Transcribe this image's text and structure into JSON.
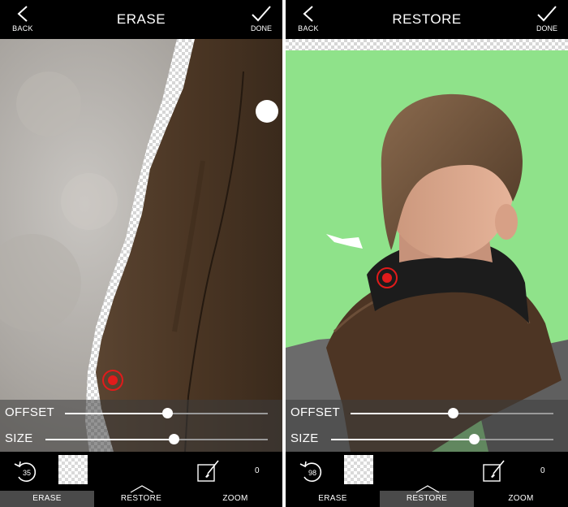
{
  "left_panel": {
    "topbar": {
      "back_label": "BACK",
      "title": "ERASE",
      "done_label": "DONE"
    },
    "sliders": {
      "offset_label": "OFFSET",
      "offset_value": 0.5,
      "size_label": "SIZE",
      "size_value": 0.57
    },
    "bottom": {
      "undo_count": "35",
      "counter": "0"
    },
    "tabs": {
      "erase": "ERASE",
      "restore": "RESTORE",
      "zoom": "ZOOM",
      "active": "erase"
    }
  },
  "right_panel": {
    "topbar": {
      "back_label": "BACK",
      "title": "RESTORE",
      "done_label": "DONE"
    },
    "sliders": {
      "offset_label": "OFFSET",
      "offset_value": 0.5,
      "size_label": "SIZE",
      "size_value": 0.57
    },
    "bottom": {
      "undo_count": "98",
      "counter": "0"
    },
    "tabs": {
      "erase": "ERASE",
      "restore": "RESTORE",
      "zoom": "ZOOM",
      "active": "restore"
    }
  },
  "colors": {
    "green_screen": "#8fe28a",
    "coat_brown": "#4a3422",
    "marker_red": "#e01b1b",
    "active_tab": "#4a4a4a"
  },
  "icons": [
    "back-chevron-icon",
    "done-check-icon",
    "undo-icon",
    "brush-icon",
    "caret-up-icon"
  ]
}
